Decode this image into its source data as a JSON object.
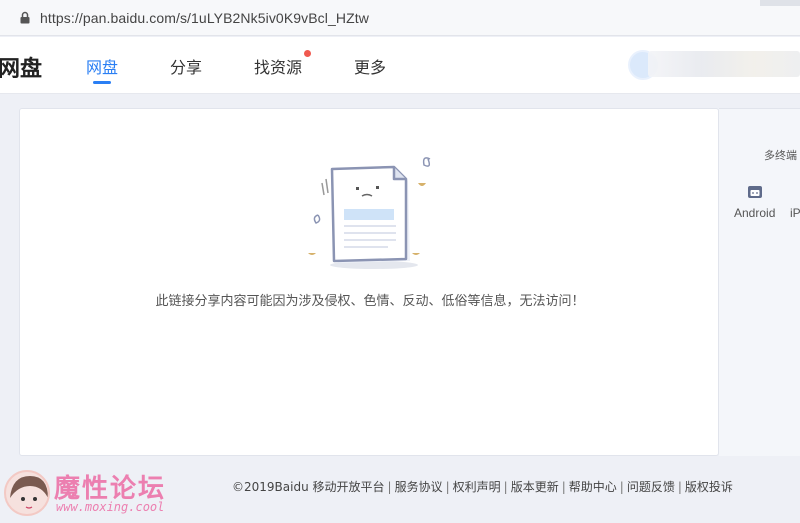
{
  "browser": {
    "url": "https://pan.baidu.com/s/1uLYB2Nk5iv0K9vBcl_HZtw"
  },
  "header": {
    "brand": "网盘",
    "nav": [
      {
        "label": "网盘"
      },
      {
        "label": "分享"
      },
      {
        "label": "找资源"
      },
      {
        "label": "更多"
      }
    ]
  },
  "main": {
    "message": "此链接分享内容可能因为涉及侵权、色情、反动、低俗等信息，无法访问！"
  },
  "side": {
    "title": "多终端",
    "platforms": [
      {
        "label": "Android"
      },
      {
        "label": "iP"
      }
    ]
  },
  "footer": {
    "copyright": "©2019Baidu",
    "links": [
      "移动开放平台",
      "服务协议",
      "权利声明",
      "版本更新",
      "帮助中心",
      "问题反馈",
      "版权投诉"
    ]
  },
  "watermark": {
    "title": "魔性论坛",
    "url": "www.moxing.cool"
  },
  "colors": {
    "accent": "#2a7ff4",
    "badge": "#f0594f",
    "watermark": "#ec7fb0"
  }
}
